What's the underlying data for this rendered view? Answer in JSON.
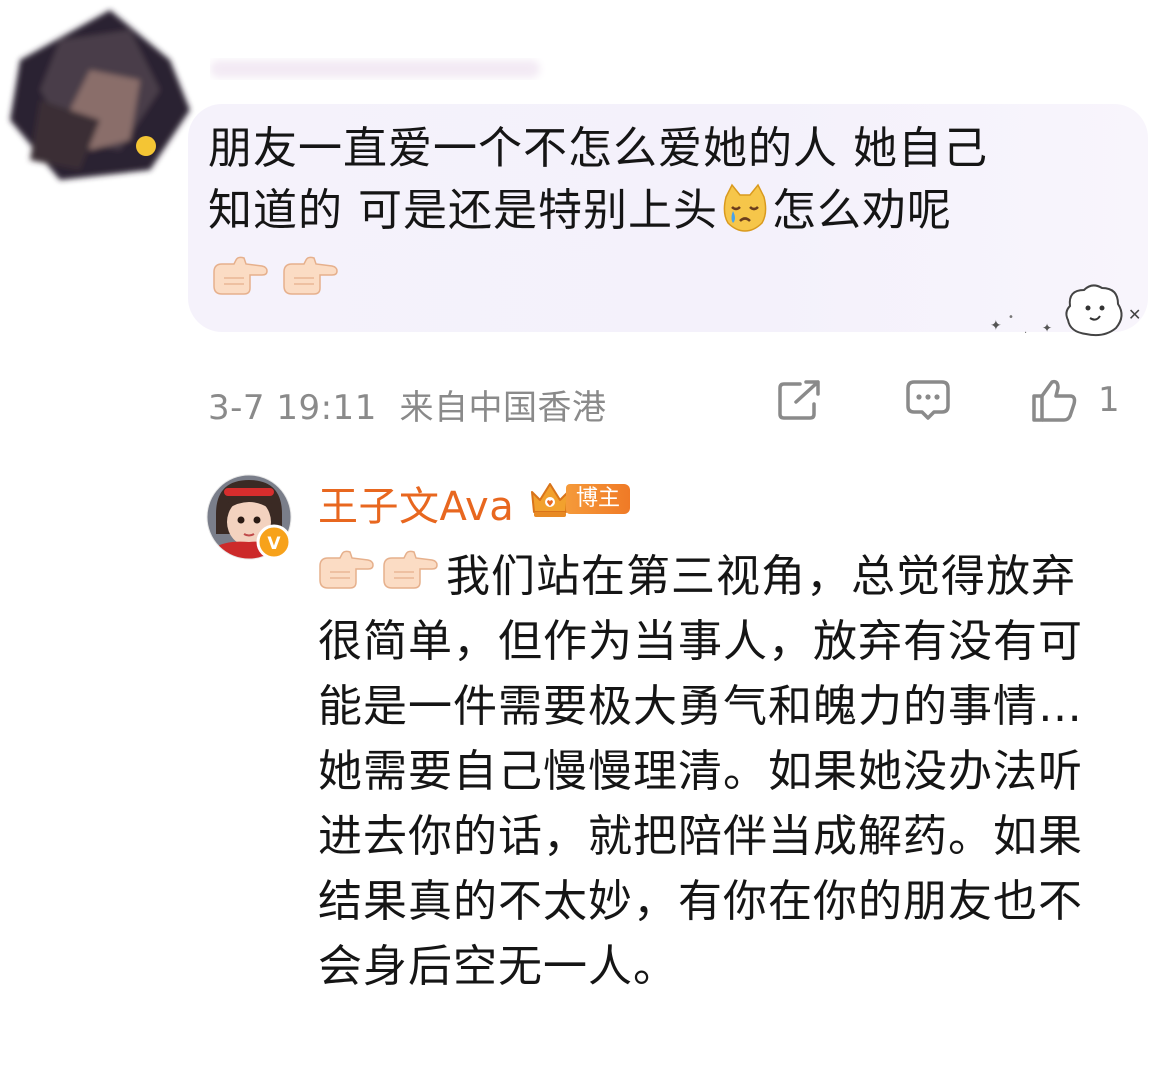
{
  "top_comment": {
    "text_line1": "朋友一直爱一个不怎么爱她的人 她自己",
    "text_line2_a": "知道的 可是还是特别上头",
    "emoji_crying_cat": "crying-cat-emoji",
    "text_line2_b": "怎么劝呢",
    "trailing_emojis": [
      "pointing-right-icon",
      "pointing-right-icon"
    ],
    "meta": {
      "timestamp": "3-7 19:11",
      "location": "来自中国香港",
      "like_count": "1"
    }
  },
  "reply": {
    "author_name": "王子文Ava",
    "badge_label": "博主",
    "verified_mark": "V",
    "text": "我们站在第三视角，总觉得放弃很简单，但作为当事人，放弃有没有可能是一件需要极大勇气和魄力的事情…她需要自己慢慢理清。如果她没办法听进去你的话，就把陪伴当成解药。如果结果真的不太妙，有你在你的朋友也不会身后空无一人。"
  },
  "colors": {
    "accent_orange": "#e8671f",
    "meta_gray": "#8a8a8a",
    "bubble_bg": "#f5f2fb"
  }
}
